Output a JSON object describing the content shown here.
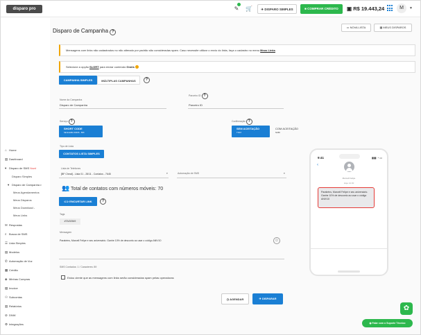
{
  "topbar": {
    "logo_text": "disparo pro",
    "tag_icon": "tag-icon",
    "cart_icon": "cart-icon",
    "disparo_simples_label": "DISPARO SIMPLES",
    "comprar_credito_label": "COMPRAR CRÉDITO",
    "balance": "R$ 19.443,24",
    "user_initial": "M",
    "accent_green": "#2db84d",
    "accent_blue": "#1a7fd4"
  },
  "sidebar": {
    "items": [
      {
        "label": "Home",
        "icon": "home-icon"
      },
      {
        "label": "Dashboard",
        "icon": "chart-icon"
      },
      {
        "label": "Disparo de SMS",
        "icon": "chevron-down-icon",
        "badge": "Novo!"
      },
      {
        "label": "Disparo Simples"
      },
      {
        "label": "Disparo de Campanha",
        "icon": "chevron-down-icon"
      },
      {
        "label": "Meus Agendamentos"
      },
      {
        "label": "Meus Disparos"
      },
      {
        "label": "Meus Download",
        "icon": "chevron-right-icon"
      },
      {
        "label": "Meus Links"
      },
      {
        "label": "Respostas",
        "icon": "chat-icon"
      },
      {
        "label": "Busca de SMS",
        "icon": "search-icon"
      },
      {
        "label": "Lista Simples",
        "icon": "list-icon"
      },
      {
        "label": "Modelos",
        "icon": "document-icon"
      },
      {
        "label": "Automação de Voz",
        "icon": "voice-icon"
      },
      {
        "label": "Crédito",
        "icon": "credit-icon"
      },
      {
        "label": "Minhas Compras",
        "icon": "tag-icon"
      },
      {
        "label": "Invoice",
        "icon": "invoice-icon"
      },
      {
        "label": "Subcontas",
        "icon": "users-icon"
      },
      {
        "label": "Relatórios",
        "icon": "report-icon"
      },
      {
        "label": "DNW",
        "icon": "block-icon"
      },
      {
        "label": "Integrações",
        "icon": "gear-icon"
      }
    ]
  },
  "main": {
    "title": "Disparo de Campanha",
    "nova_lista_label": "NOVA LISTA",
    "meus_disparos_label": "MEUS DISPAROS",
    "alert1_text": "Mensagens com links não cadastrados no não alterado por padrão são consideradas spam. Caso necessite utilizar o envio do links, faça o cadastro no menu ",
    "alert1_link": "Meus Links",
    "alert2_prefix": "Selecione a opção ",
    "alert2_option": "SLGRT",
    "alert2_suffix": " para enviar conteúdo ",
    "alert2_bold": "Gratis",
    "tab_simples": "CAMPANHA SIMPLES",
    "tab_multiplas": "MÚLTIPLAS CAMPANHAS",
    "nome_campanha_label": "Nome da Campanha",
    "nome_campanha_value": "Disparo de Campanha",
    "parceiro_label": "Parceiro ID",
    "parceiro_value": "Parceiro ID",
    "servico_label": "Serviço",
    "short_code_title": "SHORT CODE",
    "short_code_sub": "SE ELEMA   49406 - 806",
    "confirmacao_label": "Confirmação",
    "sem_aceitacao_title": "SEM ACEITAÇÃO",
    "sem_aceitacao_sub": "TNAT",
    "com_aceitacao_title": "COM ACEITAÇÃO",
    "com_aceitacao_sub": "NUBI",
    "tipo_lista_label": "Tipo de Lista",
    "contatos_lista_btn": "CONTATOS LISTA SIMPLES",
    "lista_telefones_label": "Lista de Telefones",
    "lista_telefones_value": "[BF Cheat] - Lista 01 - 28/11 - Contatos - 7645",
    "automacao_label": "Automação de SMS",
    "total_contatos": "Total de contatos com números móveis: 70",
    "encurtar_link_label": "ENCURTAR LINK",
    "tags_label": "Tags",
    "tag_value": "#TAG0549",
    "mensagem_label": "Mensagem",
    "mensagem_value": "Parabéns, Marcell Felipe e seu aniversário. Ganhe 10% de desconto ao usar o código ANIV10",
    "sms_counter": "SMS Contados: 1 / Caracteres: 89",
    "checkbox_label": "Estou ciente que as mensagens com links serão consideradas spam pelas operadoras",
    "agendar_label": "AGENDAR",
    "disparar_label": "DISPARAR"
  },
  "phone": {
    "time": "9:41",
    "status": "▮▮▮ ◔ ▭",
    "contact": "Marcell Felipe",
    "message_time": "Hoje 14:30",
    "message": "Parabéns, Marcell Felipe e seu aniversário. Ganhe 10% de desconto ao usar o código ANIV10"
  },
  "floating": {
    "whatsapp_label": "Falar com o Suporte Técnico"
  }
}
